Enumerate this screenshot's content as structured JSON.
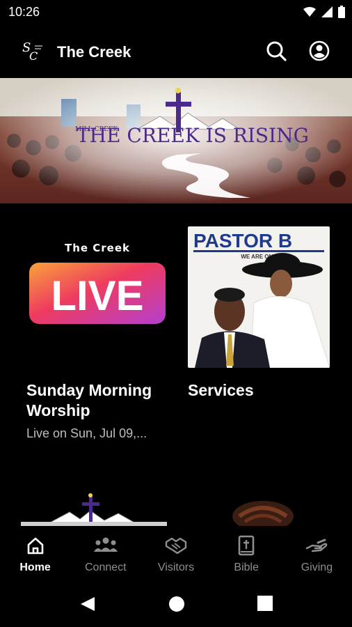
{
  "status_bar": {
    "time": "10:26"
  },
  "app_bar": {
    "title": "The Creek"
  },
  "hero": {
    "banner_text": "THE CREEK IS RISING",
    "small_text": "MILL CREEK"
  },
  "cards": [
    {
      "image_header": "The Creek",
      "image_badge": "LIVE",
      "title": "Sunday Morning Worship",
      "subtitle": "Live on Sun, Jul 09,..."
    },
    {
      "image_header": "PASTOR B",
      "image_tagline": "WE ARE ONE",
      "title": "Services",
      "subtitle": ""
    }
  ],
  "bottom_nav": {
    "items": [
      {
        "label": "Home",
        "icon": "home-icon",
        "active": true
      },
      {
        "label": "Connect",
        "icon": "group-icon",
        "active": false
      },
      {
        "label": "Visitors",
        "icon": "handshake-icon",
        "active": false
      },
      {
        "label": "Bible",
        "icon": "bible-icon",
        "active": false
      },
      {
        "label": "Giving",
        "icon": "giving-hand-icon",
        "active": false
      }
    ]
  },
  "colors": {
    "accent_live_start": "#f9a23a",
    "accent_live_end": "#b43fd1",
    "inactive_nav": "#8e8e8e",
    "banner_purple": "#4b2a8c"
  }
}
